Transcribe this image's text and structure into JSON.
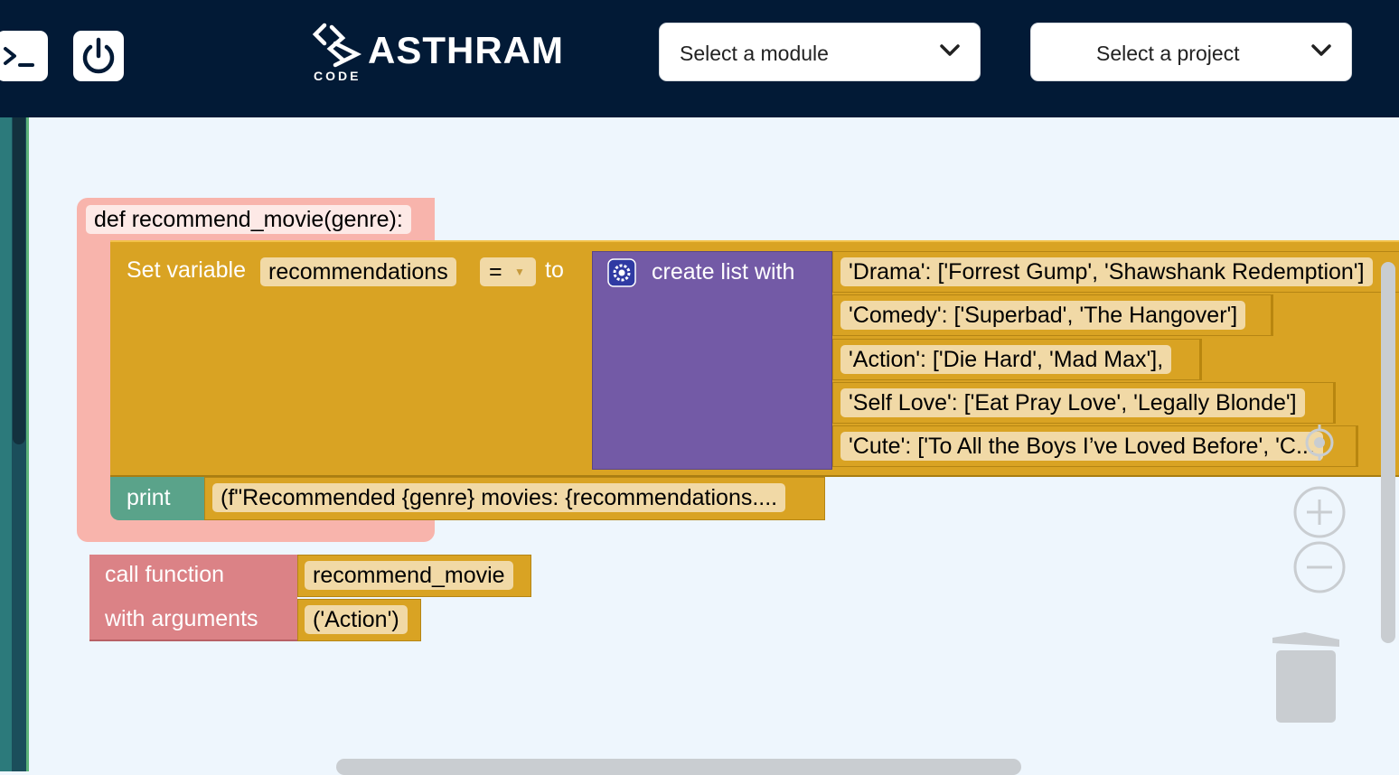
{
  "header": {
    "logo_word": "ASTHRAM",
    "logo_sub": "CODE",
    "module_select": {
      "value": "Select a module"
    },
    "project_select": {
      "value": "Select a project"
    }
  },
  "workspace": {
    "def_block": {
      "signature": "def recommend_movie(genre):"
    },
    "set_block": {
      "label": "Set variable",
      "variable": "recommendations",
      "operator": "=",
      "to_label": "to"
    },
    "list_block": {
      "label": "create list with",
      "items": [
        "'Drama': ['Forrest Gump', 'Shawshank Redemption']",
        "'Comedy': ['Superbad', 'The Hangover']",
        " 'Action': ['Die Hard', 'Mad Max'],",
        "'Self Love': ['Eat Pray Love', 'Legally Blonde']",
        "'Cute': ['To All the Boys I’ve Loved Before', 'C..."
      ]
    },
    "print_block": {
      "label": "print",
      "argument": "(f\"Recommended {genre} movies: {recommendations...."
    },
    "call_block": {
      "label1": "call function",
      "label2": "with arguments",
      "function_name": "recommend_movie",
      "arguments": "('Action')"
    }
  },
  "colors": {
    "header_bg": "#021a36",
    "workspace_bg": "#eef6fd",
    "def_block": "#f8b4ac",
    "set_block": "#d9a323",
    "list_block": "#735aa6",
    "print_block": "#5aa38a",
    "call_block": "#db8286"
  }
}
